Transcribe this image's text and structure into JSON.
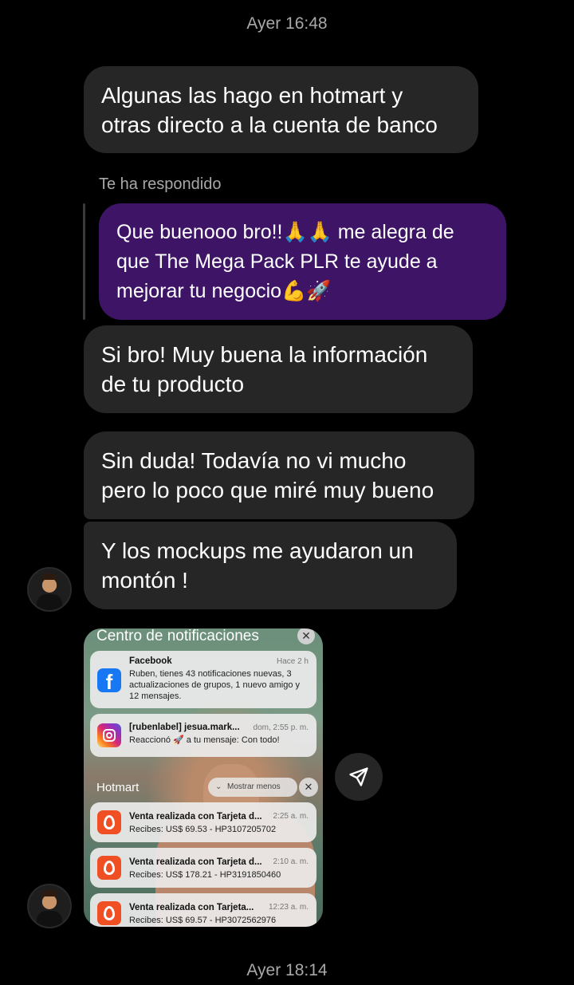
{
  "timestamps": {
    "top": "Ayer 16:48",
    "bottom": "Ayer 18:14"
  },
  "messages": {
    "m1": [
      "Algunas las hago en hotmart y",
      "otras directo a la cuenta de banco"
    ],
    "reply_label": "Te ha respondido",
    "reply": [
      "Que buenooo bro!!🙏🙏 me alegra de",
      "que The Mega Pack PLR te ayude a",
      "mejorar tu negocio💪🚀"
    ],
    "m2": [
      "Si bro! Muy buena la información",
      "de tu producto"
    ],
    "m3": [
      "Sin duda! Todavía no vi mucho",
      "pero lo poco que miré muy bueno"
    ],
    "m4": [
      "Y los mockups me ayudaron un",
      "montón !"
    ]
  },
  "shared_screenshot": {
    "title": "Centro de notificaciones",
    "close": "✕",
    "facebook": {
      "app": "Facebook",
      "time": "Hace 2 h",
      "body": "Ruben, tienes 43 notificaciones nuevas, 3 actualizaciones de grupos, 1 nuevo amigo y 12 mensajes."
    },
    "instagram": {
      "title": "[rubenlabel] jesua.mark...",
      "time": "dom, 2:55 p. m.",
      "body": "Reaccionó 🚀 a tu mensaje: Con todo!"
    },
    "group_label": "Hotmart",
    "show_less": "Mostrar menos",
    "group_close": "✕",
    "hotmart": [
      {
        "title": "Venta realizada con Tarjeta d...",
        "time": "2:25 a. m.",
        "body": "Recibes: US$ 69.53 - HP3107205702"
      },
      {
        "title": "Venta realizada con Tarjeta d...",
        "time": "2:10 a. m.",
        "body": "Recibes: US$ 178.21 - HP3191850460"
      },
      {
        "title": "Venta realizada con Tarjeta...",
        "time": "12:23 a. m.",
        "body": "Recibes: US$ 69.57 - HP3072562976"
      }
    ]
  },
  "icons": {
    "share": "send-icon",
    "facebook": "facebook-icon",
    "instagram": "instagram-icon",
    "hotmart": "hotmart-icon"
  }
}
